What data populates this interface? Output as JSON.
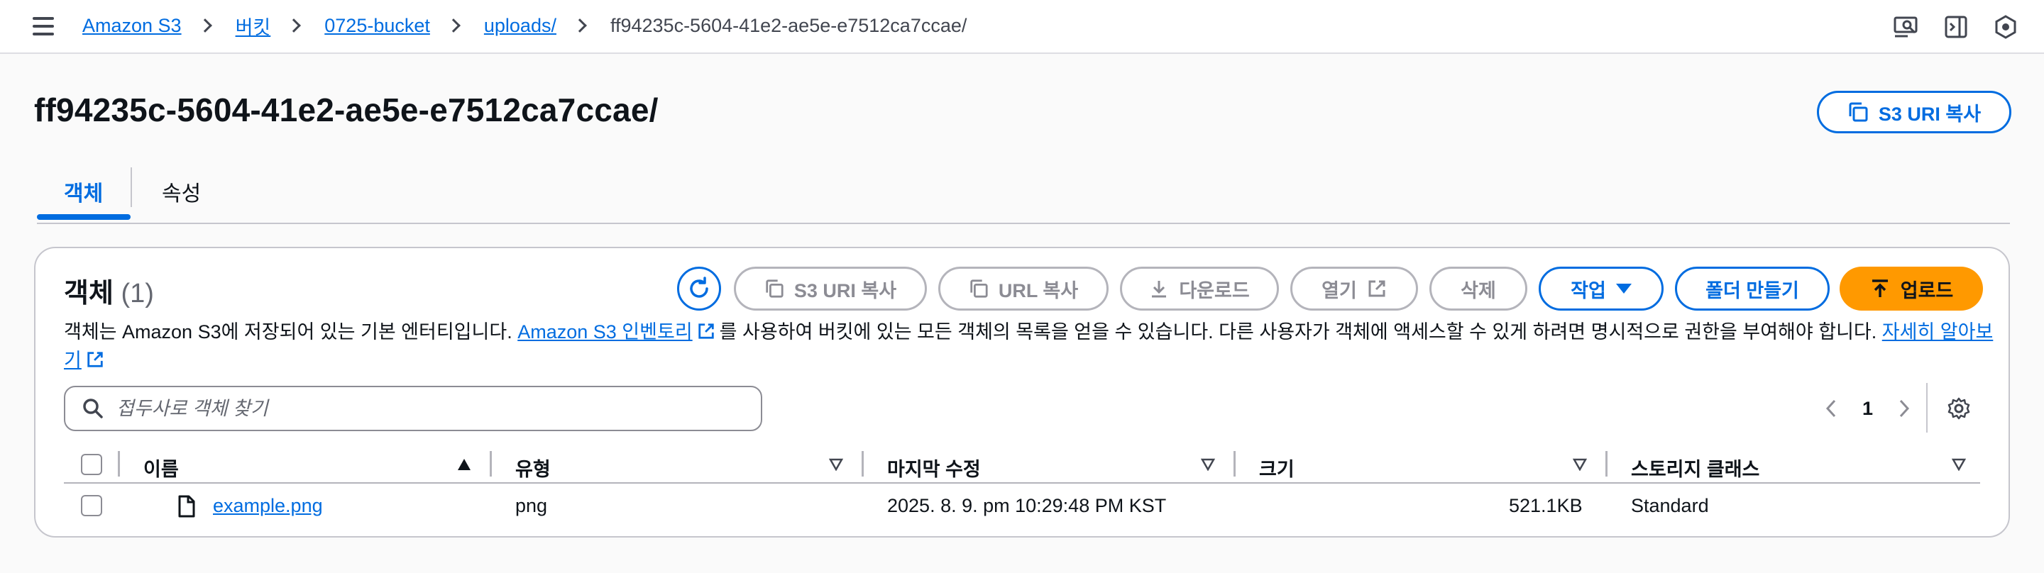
{
  "breadcrumb": {
    "items": [
      "Amazon S3",
      "버킷",
      "0725-bucket",
      "uploads/"
    ],
    "current": "ff94235c-5604-41e2-ae5e-e7512ca7ccae/"
  },
  "header": {
    "title": "ff94235c-5604-41e2-ae5e-e7512ca7ccae/",
    "copy_uri_label": "S3 URI 복사"
  },
  "tabs": [
    {
      "label": "객체",
      "selected": true
    },
    {
      "label": "속성",
      "selected": false
    }
  ],
  "objects_panel": {
    "title": "객체",
    "count": "(1)",
    "actions": {
      "s3_uri_copy": "S3 URI 복사",
      "url_copy": "URL 복사",
      "download": "다운로드",
      "open": "열기",
      "delete": "삭제",
      "actions": "작업",
      "create_folder": "폴더 만들기",
      "upload": "업로드"
    },
    "description": {
      "part1": "객체는 Amazon S3에 저장되어 있는 기본 엔터티입니다. ",
      "link1": "Amazon S3 인벤토리",
      "part2": "를 사용하여 버킷에 있는 모든 객체의 목록을 얻을 수 있습니다. 다른 사용자가 객체에 액세스할 수 있게 하려면 명시적으로 권한을 부여해야 합니다. ",
      "link2": "자세히 알아보기"
    },
    "search": {
      "placeholder": "접두사로 객체 찾기",
      "value": ""
    },
    "pagination": {
      "current_page": "1"
    },
    "table": {
      "columns": [
        "이름",
        "유형",
        "마지막 수정",
        "크기",
        "스토리지 클래스"
      ],
      "rows": [
        {
          "name": "example.png",
          "type": "png",
          "last_modified": "2025. 8. 9. pm 10:29:48 PM KST",
          "size": "521.1KB",
          "storage_class": "Standard"
        }
      ]
    }
  },
  "colors": {
    "accent": "#006ce0",
    "upload": "#ff9900",
    "disabled": "#8c8c94"
  }
}
